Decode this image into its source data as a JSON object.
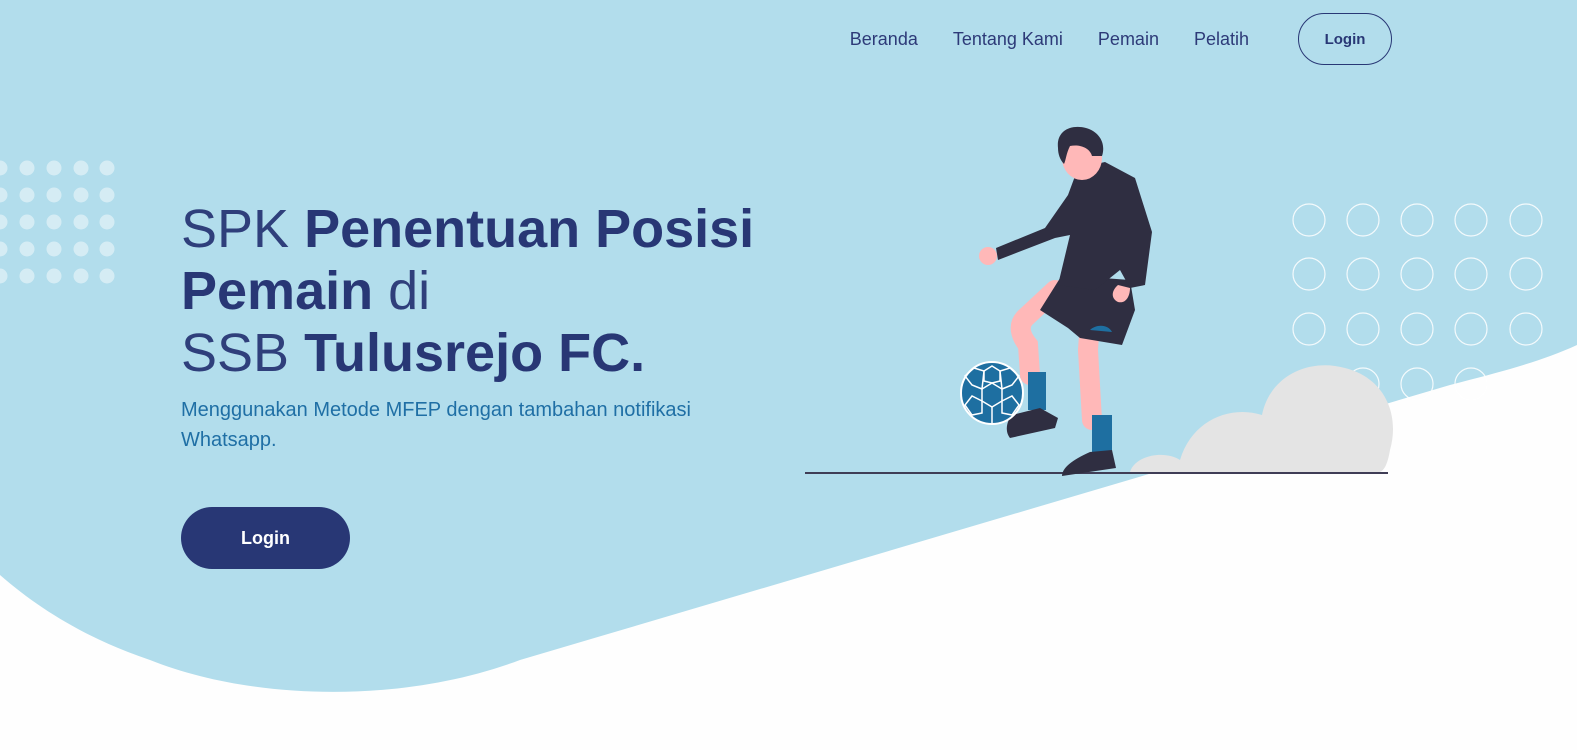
{
  "nav": {
    "links": [
      "Beranda",
      "Tentang Kami",
      "Pemain",
      "Pelatih"
    ],
    "login_label": "Login"
  },
  "hero": {
    "title": {
      "line1_light": "SPK ",
      "line1_bold": "Penentuan Posisi",
      "line2_bold": "Pemain",
      "line2_light": " di",
      "line3_light": "SSB ",
      "line3_bold": "Tulusrejo FC."
    },
    "subtitle": "Menggunakan Metode MFEP dengan tambahan notifikasi Whatsapp.",
    "login_label": "Login"
  },
  "colors": {
    "hero_bg": "#b2ddec",
    "primary": "#283775",
    "accent_text": "#1f6fa5",
    "page_bg": "#fefefe",
    "cloud": "#e4e4e4",
    "ball": "#1e6fa1",
    "player_dark": "#2f2e41",
    "skin": "#ffb8b8"
  },
  "icons": [
    "football-player-illustration",
    "soccer-ball-icon",
    "cloud-shape",
    "dot-pattern",
    "circle-pattern"
  ]
}
